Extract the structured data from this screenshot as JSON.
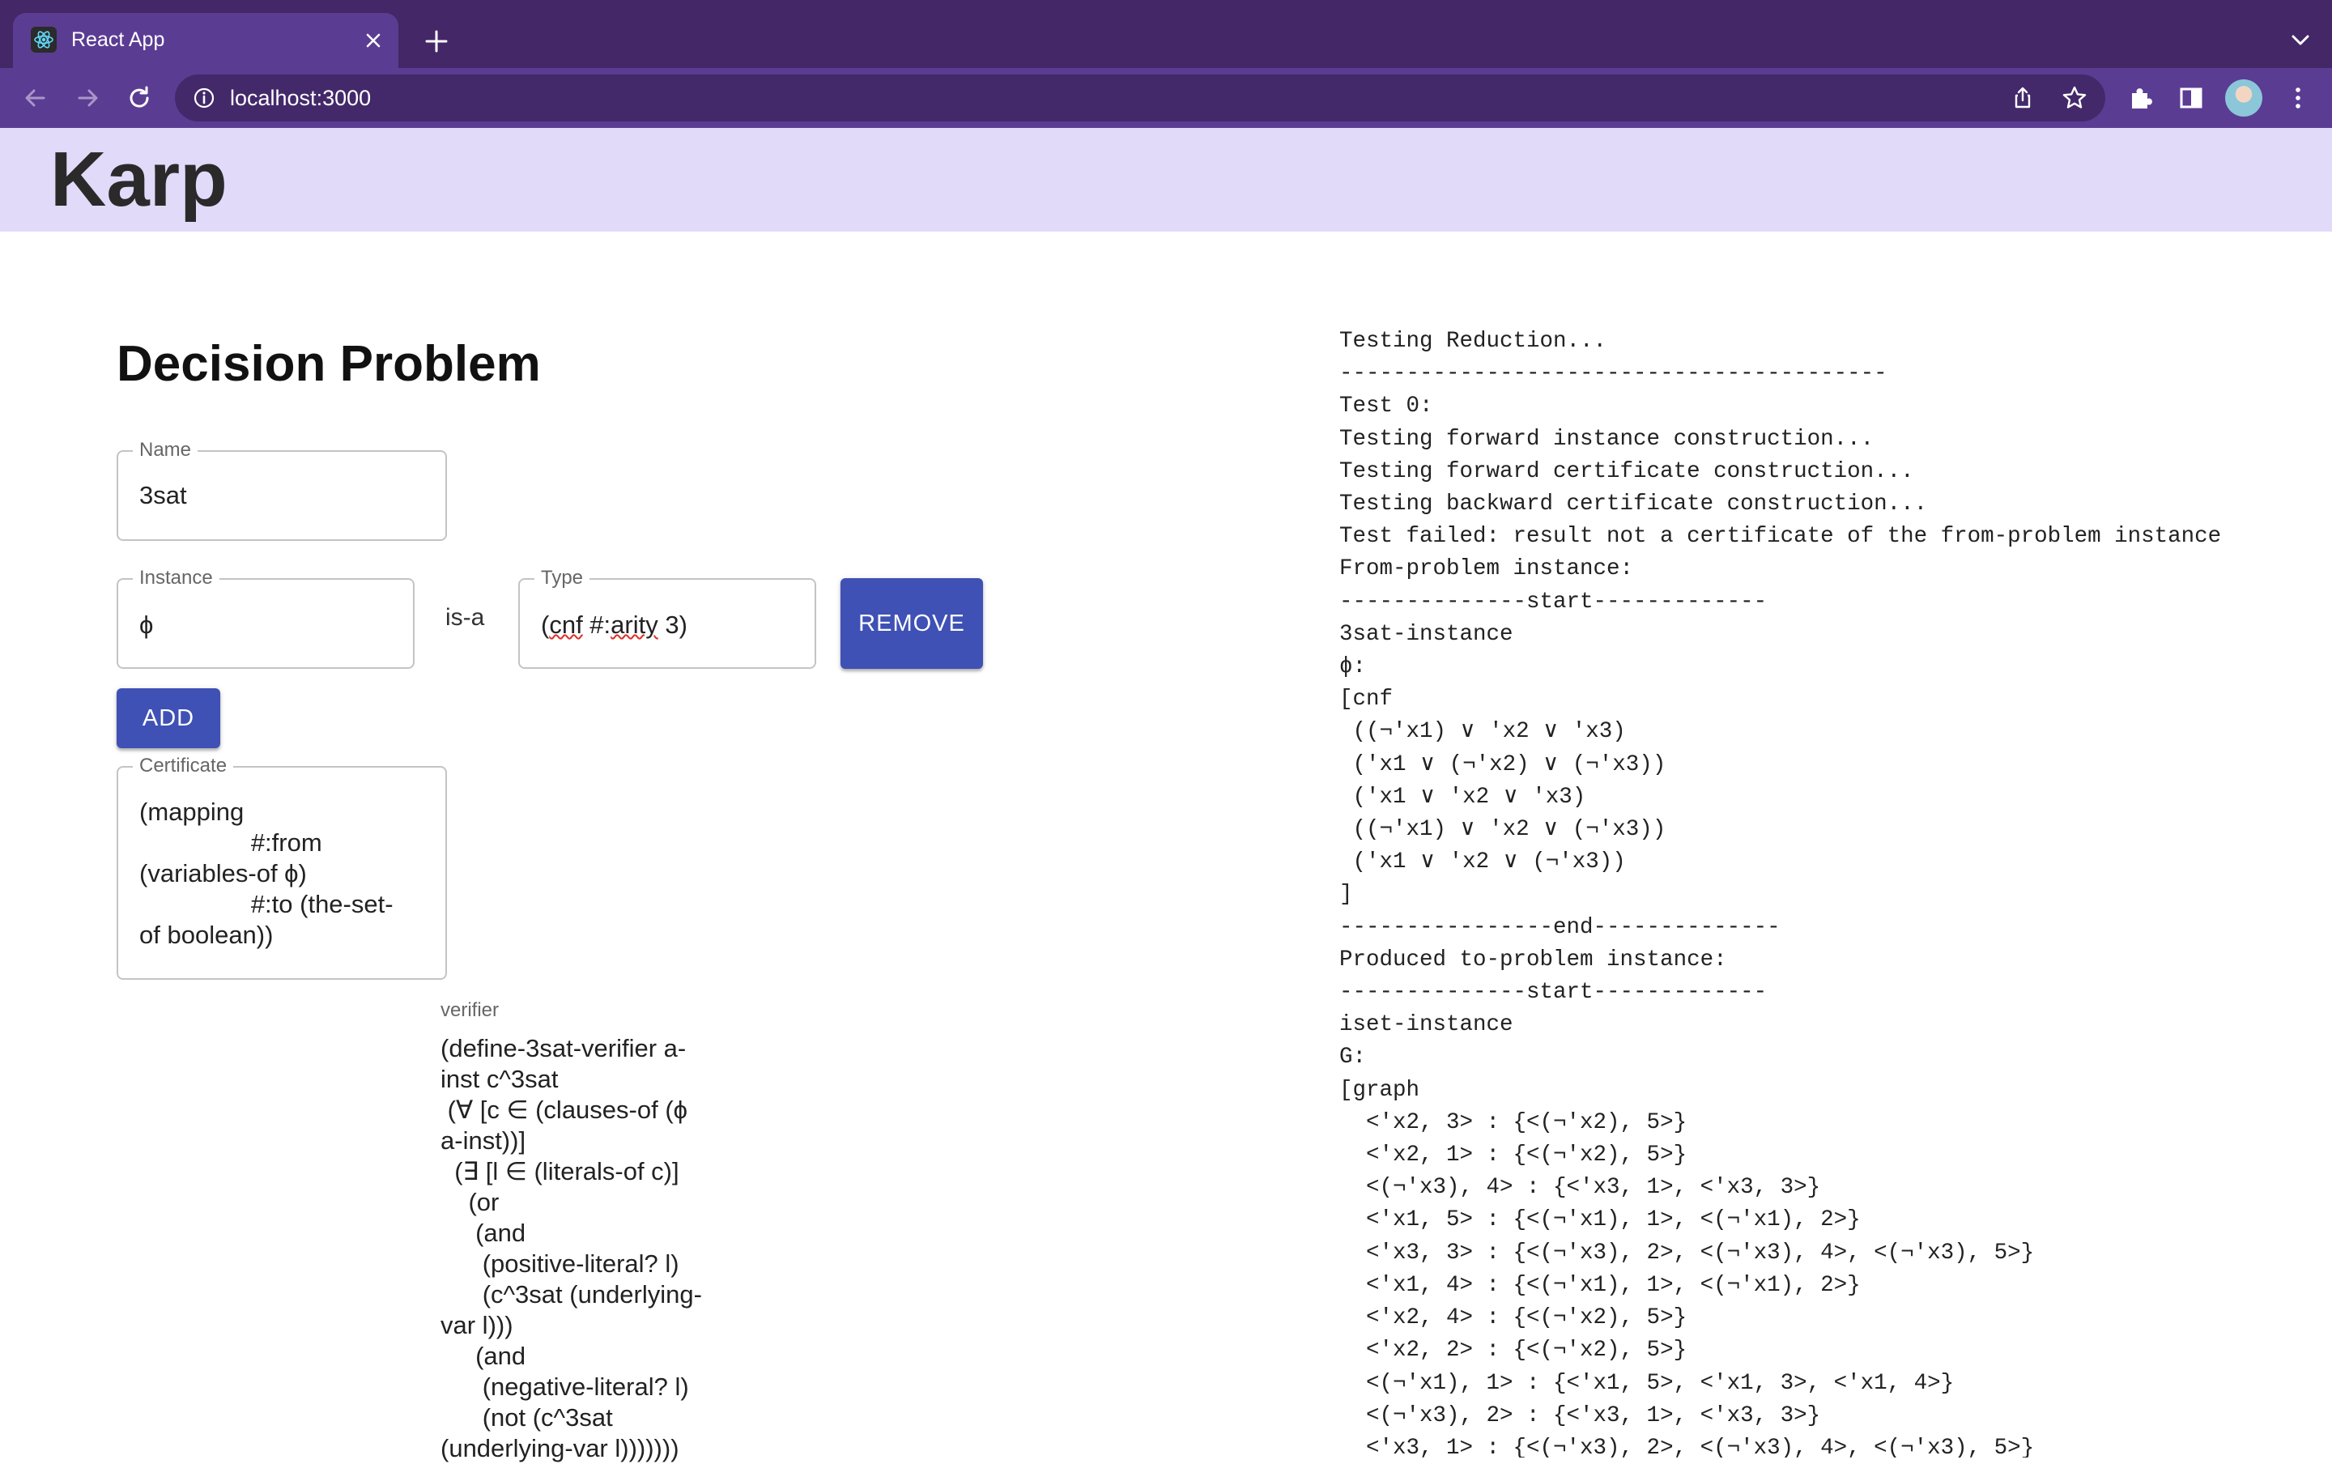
{
  "browser": {
    "tab_title": "React App",
    "url": "localhost:3000"
  },
  "app": {
    "title": "Karp"
  },
  "decision_problem": {
    "heading": "Decision Problem",
    "name": {
      "label": "Name",
      "value": "3sat"
    },
    "instance": {
      "label": "Instance",
      "value": "ϕ"
    },
    "isa": "is-a",
    "type": {
      "label": "Type",
      "value": "(cnf #:arity 3)"
    },
    "remove_label": "REMOVE",
    "add_label": "ADD",
    "certificate": {
      "label": "Certificate",
      "value": "(mapping\n                #:from\n(variables-of ϕ)\n                #:to (the-set-\nof boolean))"
    },
    "verifier": {
      "label": "verifier",
      "value": "(define-3sat-verifier a-\ninst c^3sat\n (∀ [c ∈ (clauses-of (ϕ\na-inst))]\n  (∃ [l ∈ (literals-of c)]\n    (or\n     (and\n      (positive-literal? l)\n      (c^3sat (underlying-\nvar l)))\n     (and\n      (negative-literal? l)\n      (not (c^3sat\n(underlying-var l)))))))"
    }
  },
  "output": {
    "lines": [
      "Testing Reduction...",
      "-----------------------------------------",
      "Test 0:",
      "Testing forward instance construction...",
      "Testing forward certificate construction...",
      "Testing backward certificate construction...",
      "Test failed: result not a certificate of the from-problem instance",
      "From-problem instance:",
      "--------------start-------------",
      "3sat-instance",
      "ϕ:",
      "[cnf",
      " ((¬'x1) ∨ 'x2 ∨ 'x3)",
      " ('x1 ∨ (¬'x2) ∨ (¬'x3))",
      " ('x1 ∨ 'x2 ∨ 'x3)",
      " ((¬'x1) ∨ 'x2 ∨ (¬'x3))",
      " ('x1 ∨ 'x2 ∨ (¬'x3))",
      "]",
      "----------------end--------------",
      "Produced to-problem instance:",
      "--------------start-------------",
      "iset-instance",
      "G:",
      "[graph",
      "  <'x2, 3> : {<(¬'x2), 5>}",
      "  <'x2, 1> : {<(¬'x2), 5>}",
      "  <(¬'x3), 4> : {<'x3, 1>, <'x3, 3>}",
      "  <'x1, 5> : {<(¬'x1), 1>, <(¬'x1), 2>}",
      "  <'x3, 3> : {<(¬'x3), 2>, <(¬'x3), 4>, <(¬'x3), 5>}",
      "  <'x1, 4> : {<(¬'x1), 1>, <(¬'x1), 2>}",
      "  <'x2, 4> : {<(¬'x2), 5>}",
      "  <'x2, 2> : {<(¬'x2), 5>}",
      "  <(¬'x1), 1> : {<'x1, 5>, <'x1, 3>, <'x1, 4>}",
      "  <(¬'x3), 2> : {<'x3, 1>, <'x3, 3>}",
      "  <'x3, 1> : {<(¬'x3), 2>, <(¬'x3), 4>, <(¬'x3), 5>}"
    ]
  },
  "icons": {
    "favicon": "react-logo-icon",
    "tab_close": "close-icon",
    "new_tab": "plus-icon",
    "tab_menu": "chevron-down-icon",
    "back": "arrow-left-icon",
    "forward": "arrow-right-icon",
    "reload": "reload-icon",
    "site_info": "info-icon",
    "share": "share-icon",
    "bookmark": "star-icon",
    "extensions": "puzzle-icon",
    "side_panel": "sidebar-icon",
    "profile": "avatar",
    "menu": "kebab-menu-icon"
  },
  "colors": {
    "browser_frame": "#432766",
    "browser_toolbar": "#5b3c93",
    "app_header": "#e1daf9",
    "button": "#3f51b5"
  }
}
